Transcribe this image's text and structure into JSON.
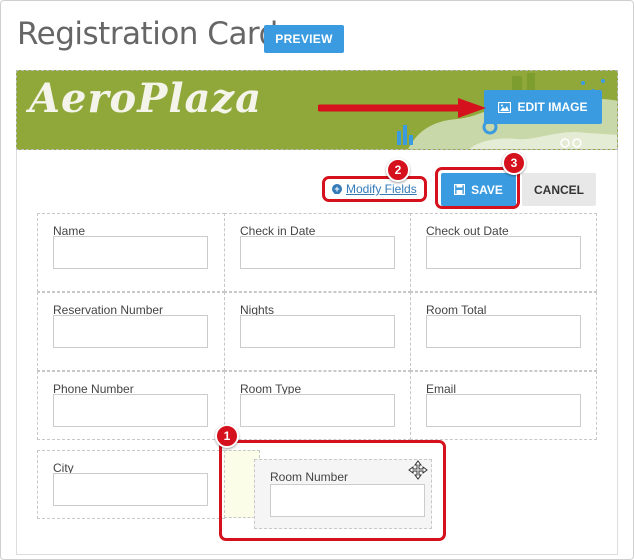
{
  "header": {
    "title": "Registration Cards",
    "preview_label": "PREVIEW"
  },
  "banner": {
    "logo_text": "AeroPlaza",
    "edit_image_label": "EDIT IMAGE"
  },
  "toolbar": {
    "modify_fields_label": "Modify Fields",
    "save_label": "SAVE",
    "cancel_label": "CANCEL"
  },
  "fields": [
    {
      "label": "Name",
      "value": ""
    },
    {
      "label": "Check in Date",
      "value": ""
    },
    {
      "label": "Check out Date",
      "value": ""
    },
    {
      "label": "Reservation Number",
      "value": ""
    },
    {
      "label": "Nights",
      "value": ""
    },
    {
      "label": "Room Total",
      "value": ""
    },
    {
      "label": "Phone Number",
      "value": ""
    },
    {
      "label": "Room Type",
      "value": ""
    },
    {
      "label": "Email",
      "value": ""
    },
    {
      "label": "City",
      "value": ""
    }
  ],
  "dragging_field": {
    "label": "Room Number",
    "value": ""
  },
  "annotations": {
    "step1": "1",
    "step2": "2",
    "step3": "3",
    "highlight_color": "#d4111c"
  },
  "colors": {
    "primary": "#3a9be0",
    "banner_green": "#8fa839"
  },
  "icons": {
    "preview": "none",
    "edit_image": "image-icon",
    "save": "floppy-disk-icon",
    "modify": "plus-circle-icon",
    "move": "move-cursor-icon",
    "arrow": "red-arrow-right"
  }
}
